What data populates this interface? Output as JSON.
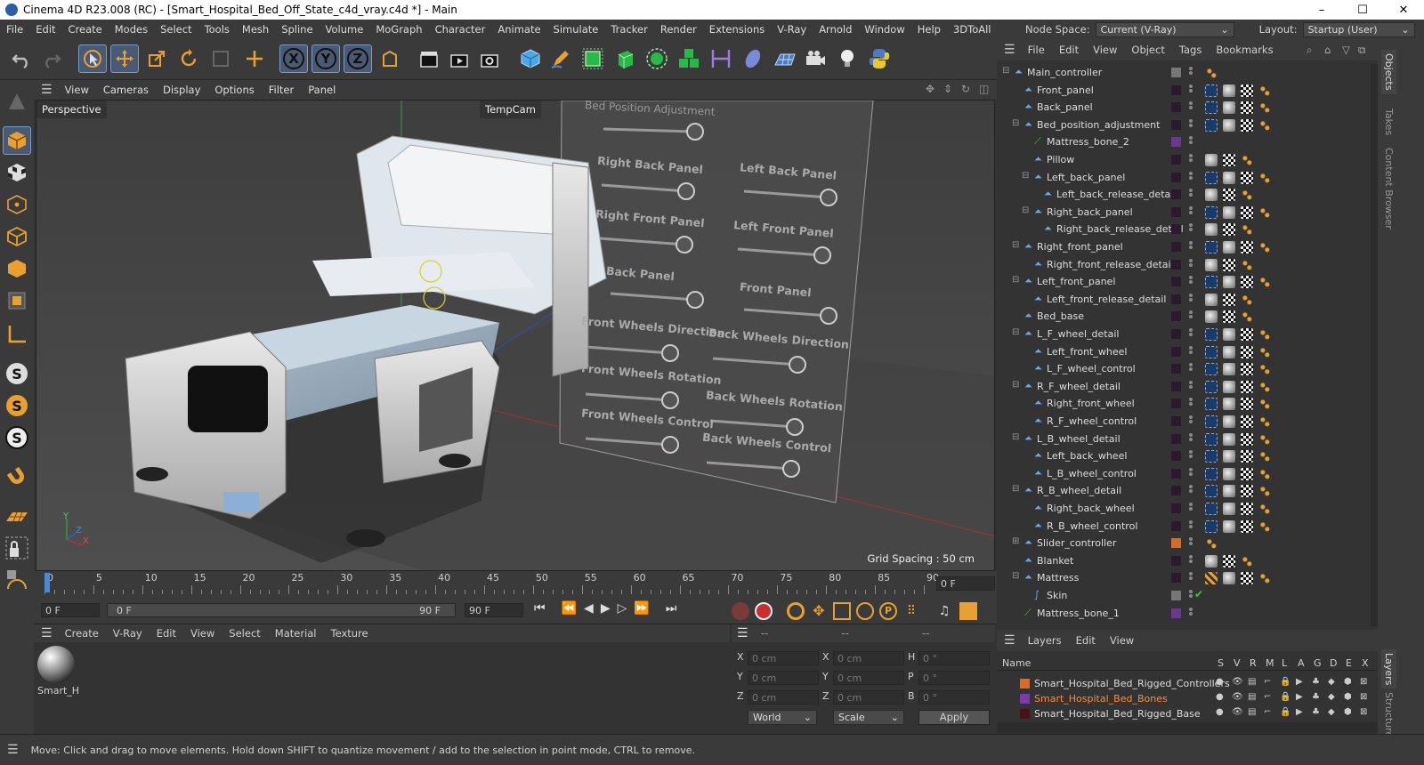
{
  "window": {
    "title": "Cinema 4D R23.008 (RC) - [Smart_Hospital_Bed_Off_State_c4d_vray.c4d *] - Main",
    "min": "–",
    "max": "☐",
    "close": "✕"
  },
  "menu": [
    "File",
    "Edit",
    "Create",
    "Modes",
    "Select",
    "Tools",
    "Mesh",
    "Spline",
    "Volume",
    "MoGraph",
    "Character",
    "Animate",
    "Simulate",
    "Tracker",
    "Render",
    "Extensions",
    "V-Ray",
    "Arnold",
    "Window",
    "Help",
    "3DToAll"
  ],
  "nodespace": {
    "label": "Node Space:",
    "value": "Current (V-Ray)",
    "layout_label": "Layout:",
    "layout_value": "Startup (User)"
  },
  "viewport_menu": [
    "View",
    "Cameras",
    "Display",
    "Options",
    "Filter",
    "Panel"
  ],
  "viewport": {
    "name": "Perspective",
    "camera": "TempCam",
    "grid_spacing": "Grid Spacing : 50 cm",
    "panel_title": "Bed Position Adjustment",
    "slider_labels": [
      "Right Back Panel",
      "Left Back Panel",
      "Right Front Panel",
      "Left Front Panel",
      "Back Panel",
      "Front Panel",
      "Front Wheels Direction",
      "Back Wheels Direction",
      "Front Wheels Rotation",
      "Back Wheels Rotation",
      "Front Wheels Control",
      "Back Wheels Control"
    ],
    "axis_y": "Y",
    "axis_z": "Z",
    "axis_x": "X"
  },
  "timeline": {
    "ticks": [
      "0",
      "5",
      "10",
      "15",
      "20",
      "25",
      "30",
      "35",
      "40",
      "45",
      "50",
      "55",
      "60",
      "65",
      "70",
      "75",
      "80",
      "85",
      "90"
    ],
    "current": "0 F",
    "start": "0 F",
    "range_start": "0 F",
    "range_end": "90 F",
    "end": "90 F"
  },
  "material_menu": [
    "Create",
    "V-Ray",
    "Edit",
    "View",
    "Select",
    "Material",
    "Texture"
  ],
  "material": {
    "name": "Smart_H"
  },
  "attributes": {
    "headers": [
      "--",
      "--",
      "--"
    ],
    "rows": [
      {
        "a": "X",
        "av": "0 cm",
        "b": "X",
        "bv": "0 cm",
        "c": "H",
        "cv": "0 °"
      },
      {
        "a": "Y",
        "av": "0 cm",
        "b": "Y",
        "bv": "0 cm",
        "c": "P",
        "cv": "0 °"
      },
      {
        "a": "Z",
        "av": "0 cm",
        "b": "Z",
        "bv": "0 cm",
        "c": "B",
        "cv": "0 °"
      }
    ],
    "coord": "World",
    "mode": "Scale",
    "apply": "Apply"
  },
  "object_menu": [
    "File",
    "Edit",
    "View",
    "Object",
    "Tags",
    "Bookmarks"
  ],
  "objects": [
    {
      "name": "Main_controller",
      "depth": 0,
      "expand": "−",
      "tags": "o"
    },
    {
      "name": "Front_panel",
      "depth": 1,
      "expand": "",
      "tags": "gcbo"
    },
    {
      "name": "Back_panel",
      "depth": 1,
      "expand": "",
      "tags": "gcbo"
    },
    {
      "name": "Bed_position_adjustment",
      "depth": 1,
      "expand": "−",
      "tags": "gcbo"
    },
    {
      "name": "Mattress_bone_2",
      "depth": 2,
      "expand": "",
      "tags": ""
    },
    {
      "name": "Pillow",
      "depth": 2,
      "expand": "",
      "tags": "cbo"
    },
    {
      "name": "Left_back_panel",
      "depth": 2,
      "expand": "−",
      "tags": "gcbo"
    },
    {
      "name": "Left_back_release_detail",
      "depth": 3,
      "expand": "",
      "tags": "cbo"
    },
    {
      "name": "Right_back_panel",
      "depth": 2,
      "expand": "−",
      "tags": "gcbo"
    },
    {
      "name": "Right_back_release_detail",
      "depth": 3,
      "expand": "",
      "tags": "cbo"
    },
    {
      "name": "Right_front_panel",
      "depth": 1,
      "expand": "−",
      "tags": "gcbo"
    },
    {
      "name": "Right_front_release_detail",
      "depth": 2,
      "expand": "",
      "tags": "cbo"
    },
    {
      "name": "Left_front_panel",
      "depth": 1,
      "expand": "−",
      "tags": "gcbo"
    },
    {
      "name": "Left_front_release_detail",
      "depth": 2,
      "expand": "",
      "tags": "cbo"
    },
    {
      "name": "Bed_base",
      "depth": 1,
      "expand": "",
      "tags": "cbo"
    },
    {
      "name": "L_F_wheel_detail",
      "depth": 1,
      "expand": "−",
      "tags": "gcbo"
    },
    {
      "name": "Left_front_wheel",
      "depth": 2,
      "expand": "",
      "tags": "gcbo"
    },
    {
      "name": "L_F_wheel_control",
      "depth": 2,
      "expand": "",
      "tags": "gcbo"
    },
    {
      "name": "R_F_wheel_detail",
      "depth": 1,
      "expand": "−",
      "tags": "gcbo"
    },
    {
      "name": "Right_front_wheel",
      "depth": 2,
      "expand": "",
      "tags": "gcbo"
    },
    {
      "name": "R_F_wheel_control",
      "depth": 2,
      "expand": "",
      "tags": "gcbo"
    },
    {
      "name": "L_B_wheel_detail",
      "depth": 1,
      "expand": "−",
      "tags": "gcbo"
    },
    {
      "name": "Left_back_wheel",
      "depth": 2,
      "expand": "",
      "tags": "gcbo"
    },
    {
      "name": "L_B_wheel_control",
      "depth": 2,
      "expand": "",
      "tags": "gcbo"
    },
    {
      "name": "R_B_wheel_detail",
      "depth": 1,
      "expand": "−",
      "tags": "gcbo"
    },
    {
      "name": "Right_back_wheel",
      "depth": 2,
      "expand": "",
      "tags": "gcbo"
    },
    {
      "name": "R_B_wheel_control",
      "depth": 2,
      "expand": "",
      "tags": "gcbo"
    },
    {
      "name": "Slider_controller",
      "depth": 1,
      "expand": "+",
      "tags": "o"
    },
    {
      "name": "Blanket",
      "depth": 1,
      "expand": "",
      "tags": "cbo"
    },
    {
      "name": "Mattress",
      "depth": 1,
      "expand": "−",
      "tags": "mcbo"
    },
    {
      "name": "Skin",
      "depth": 2,
      "expand": "",
      "tags": ""
    },
    {
      "name": "Mattress_bone_1",
      "depth": 1,
      "expand": "",
      "tags": ""
    }
  ],
  "layers_menu": [
    "Layers",
    "Edit",
    "View"
  ],
  "layers_header": {
    "name": "Name",
    "cols": [
      "S",
      "V",
      "R",
      "M",
      "L",
      "A",
      "G",
      "D",
      "E",
      "X"
    ]
  },
  "layers": [
    {
      "name": "Smart_Hospital_Bed_Rigged_Controllers",
      "color": "#d86a2a",
      "highlight": false
    },
    {
      "name": "Smart_Hospital_Bed_Bones",
      "color": "#7a3aa8",
      "highlight": true
    },
    {
      "name": "Smart_Hospital_Bed_Rigged_Base",
      "color": "#4a1020",
      "highlight": false
    }
  ],
  "right_tabs": [
    "Objects",
    "Takes",
    "Content Browser",
    "Layers",
    "Structure"
  ],
  "status": "Move: Click and drag to move elements. Hold down SHIFT to quantize movement / add to the selection in point mode, CTRL to remove.",
  "colors": {
    "accent": "#4a8ad8",
    "orange": "#e8a030",
    "highlight_text": "#ff8a3a"
  }
}
